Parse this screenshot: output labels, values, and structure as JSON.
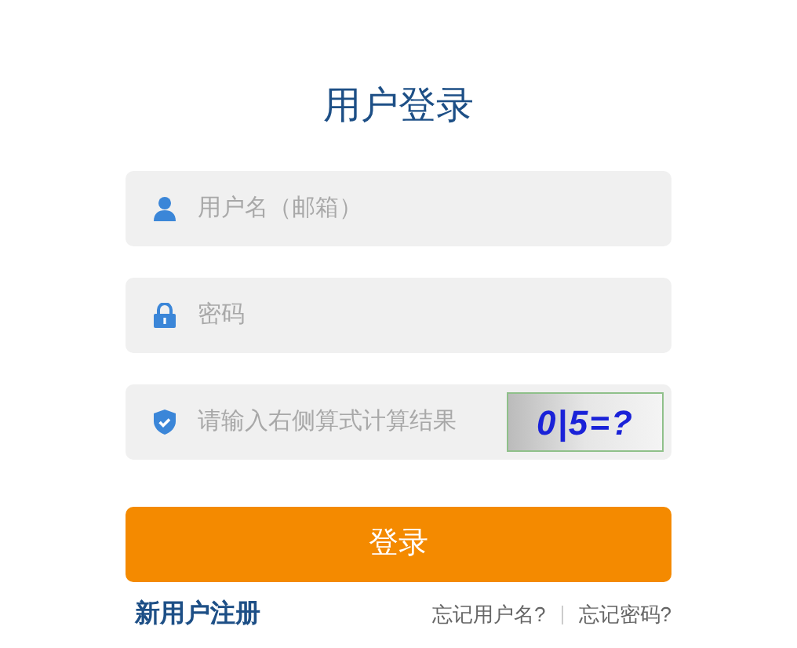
{
  "title": "用户登录",
  "fields": [
    {
      "kind": "user",
      "placeholder": "用户名（邮箱）"
    },
    {
      "kind": "lock",
      "placeholder": "密码"
    },
    {
      "kind": "shield",
      "placeholder": "请输入右侧算式计算结果",
      "captcha": "0|5=?"
    }
  ],
  "submit": "登录",
  "register": "新用户注册",
  "links": [
    "忘记用户名?",
    "忘记密码?"
  ]
}
